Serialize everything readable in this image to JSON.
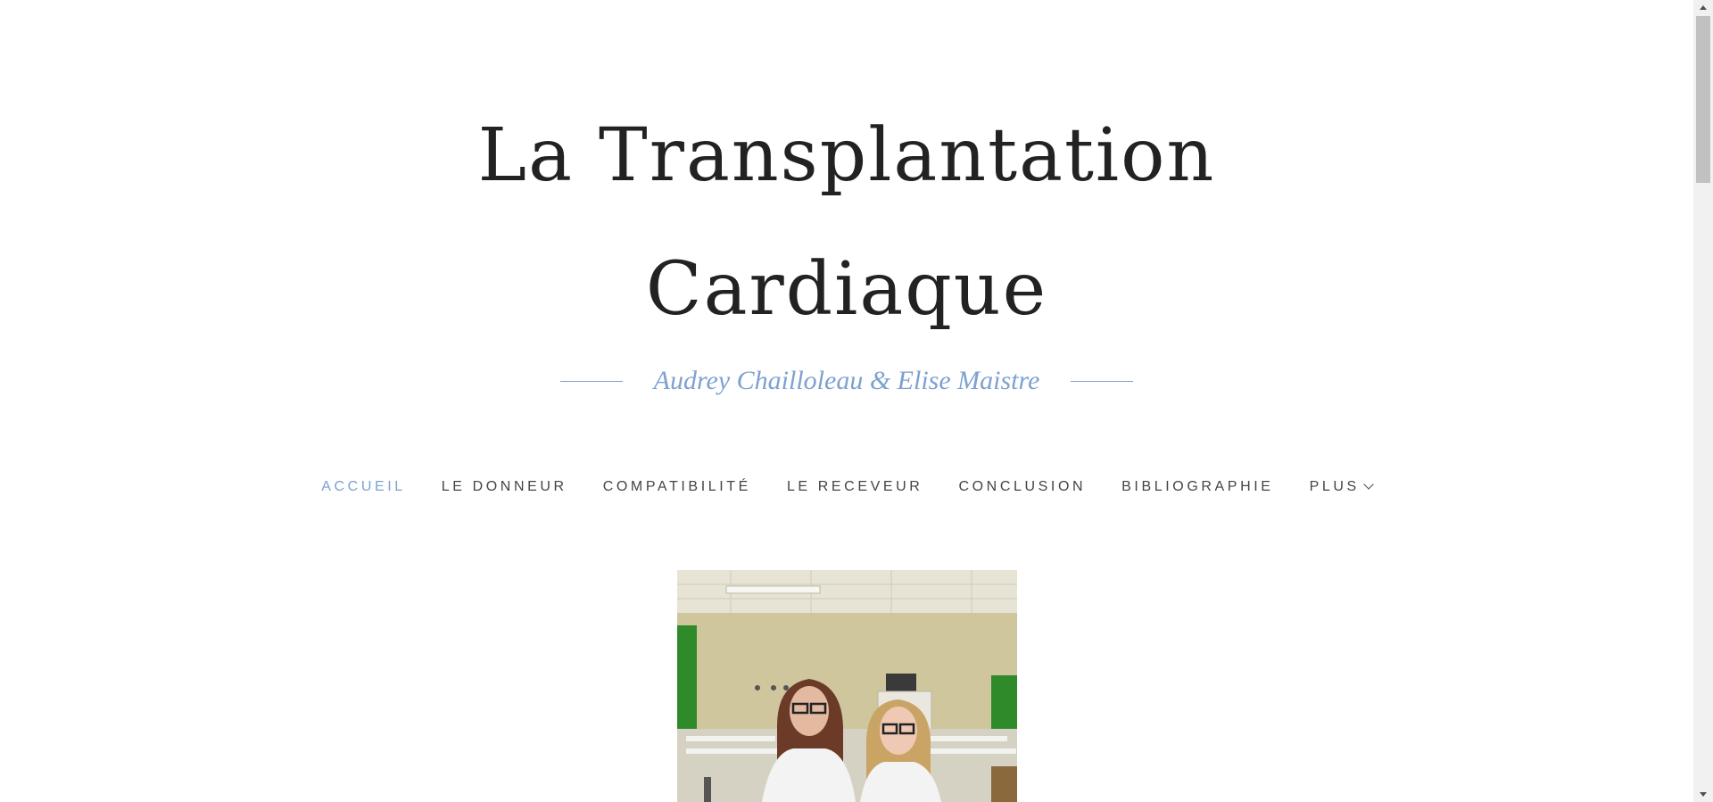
{
  "site": {
    "title_line1": "La Transplantation",
    "title_line2": "Cardiaque",
    "subtitle": "Audrey Chailloleau & Elise Maistre"
  },
  "nav": {
    "items": [
      {
        "label": "ACCUEIL",
        "active": true
      },
      {
        "label": "LE DONNEUR",
        "active": false
      },
      {
        "label": "COMPATIBILITÉ",
        "active": false
      },
      {
        "label": "LE RECEVEUR",
        "active": false
      },
      {
        "label": "CONCLUSION",
        "active": false
      },
      {
        "label": "BIBLIOGRAPHIE",
        "active": false
      },
      {
        "label": "PLUS",
        "active": false,
        "icon": "chevron-down-icon"
      }
    ]
  },
  "colors": {
    "accent": "#7da1d0",
    "title": "#222222",
    "nav_text": "#444444"
  }
}
